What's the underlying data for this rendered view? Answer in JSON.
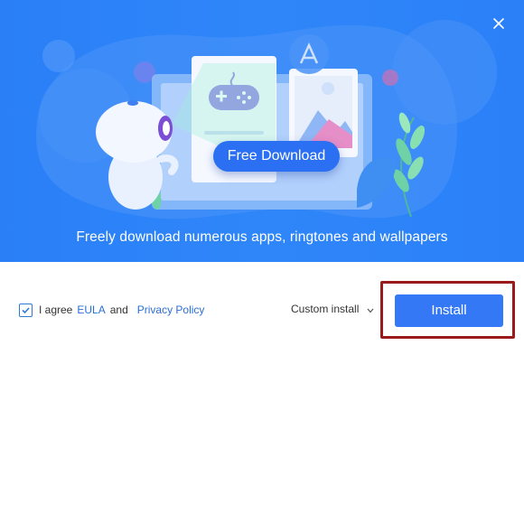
{
  "hero": {
    "cta_label": "Free Download",
    "tagline": "Freely download numerous apps, ringtones and wallpapers"
  },
  "consent": {
    "checked": true,
    "prefix": "I agree",
    "eula_link": "EULA",
    "connector": "and",
    "privacy_link": "Privacy Policy"
  },
  "actions": {
    "custom_install_label": "Custom install",
    "install_label": "Install"
  },
  "icons": {
    "close": "close-icon",
    "check": "check-icon",
    "chevron": "chevron-down-icon",
    "gamepad": "gamepad-icon",
    "image": "image-icon",
    "app_store": "app-store-icon",
    "leaf": "leaf-icon",
    "robot": "robot-mascot"
  },
  "colors": {
    "hero_bg": "#2a7ff7",
    "accent": "#3478f6",
    "link": "#2a6fd6",
    "highlight": "#9a1b1b"
  }
}
